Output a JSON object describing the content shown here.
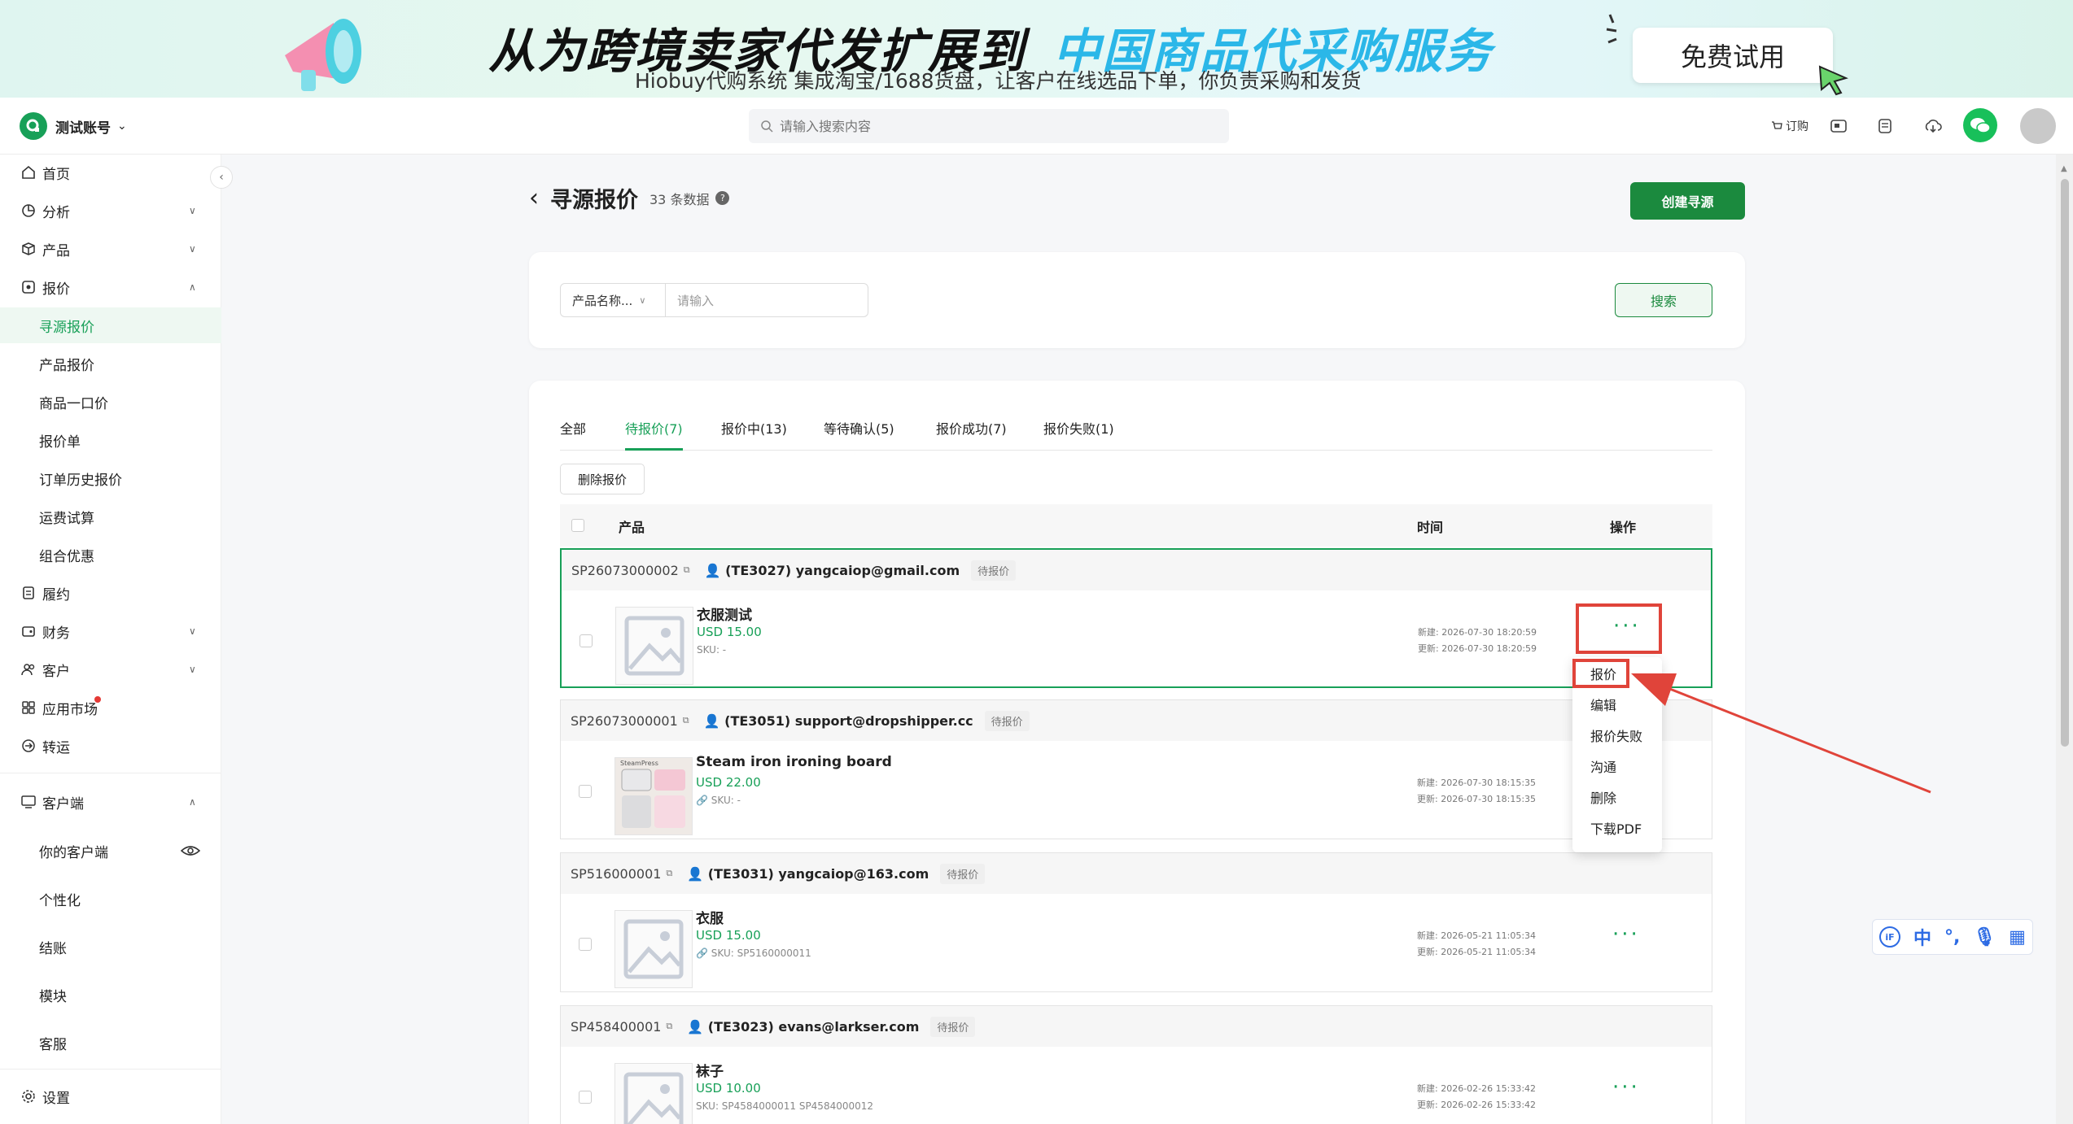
{
  "banner": {
    "headline_a": "从为跨境卖家代发扩展到",
    "headline_b": "中国商品代采购服务",
    "subtitle": "Hiobuy代购系统 集成淘宝/1688货盘，让客户在线选品下单，你负责采购和发货",
    "trial_button": "免费试用"
  },
  "topbar": {
    "account_name": "测试账号",
    "search_placeholder": "请输入搜索内容",
    "subscribe_label": "订购"
  },
  "sidebar": {
    "items": [
      {
        "label": "首页",
        "icon": "home-icon"
      },
      {
        "label": "分析",
        "icon": "chart-icon"
      },
      {
        "label": "产品",
        "icon": "box-icon"
      },
      {
        "label": "报价",
        "icon": "quote-icon"
      },
      {
        "label": "寻源报价"
      },
      {
        "label": "产品报价"
      },
      {
        "label": "商品一口价"
      },
      {
        "label": "报价单"
      },
      {
        "label": "订单历史报价"
      },
      {
        "label": "运费试算"
      },
      {
        "label": "组合优惠"
      },
      {
        "label": "履约",
        "icon": "fulfill-icon"
      },
      {
        "label": "财务",
        "icon": "finance-icon"
      },
      {
        "label": "客户",
        "icon": "customers-icon"
      },
      {
        "label": "应用市场",
        "icon": "apps-icon"
      },
      {
        "label": "转运",
        "icon": "transship-icon"
      },
      {
        "label": "客户端",
        "icon": "monitor-icon"
      },
      {
        "label": "你的客户端"
      },
      {
        "label": "个性化"
      },
      {
        "label": "结账"
      },
      {
        "label": "模块"
      },
      {
        "label": "客服"
      },
      {
        "label": "设置",
        "icon": "settings-icon"
      }
    ]
  },
  "page": {
    "title": "寻源报价",
    "count": "33 条数据",
    "create_button": "创建寻源"
  },
  "filter": {
    "field_select": "产品名称...",
    "input_placeholder": "请输入",
    "search_button": "搜索"
  },
  "tabs": [
    {
      "label": "全部"
    },
    {
      "label": "待报价(7)"
    },
    {
      "label": "报价中(13)"
    },
    {
      "label": "等待确认(5)"
    },
    {
      "label": "报价成功(7)"
    },
    {
      "label": "报价失败(1)"
    }
  ],
  "delete_button": "删除报价",
  "table_headers": {
    "product": "产品",
    "time": "时间",
    "actions": "操作"
  },
  "orders": [
    {
      "id": "SP26073000002",
      "user": "(TE3027) yangcaiop@gmail.com",
      "status": "待报价",
      "product": "衣服测试",
      "price": "USD 15.00",
      "sku": "SKU: -",
      "created": "新建: 2026-07-30 18:20:59",
      "updated": "更新: 2026-07-30 18:20:59"
    },
    {
      "id": "SP26073000001",
      "user": "(TE3051) support@dropshipper.cc",
      "status": "待报价",
      "product": "Steam iron ironing board",
      "price": "USD 22.00",
      "sku": "SKU: -",
      "created": "新建: 2026-07-30 18:15:35",
      "updated": "更新: 2026-07-30 18:15:35",
      "image_text": "SteamPress"
    },
    {
      "id": "SP516000001",
      "user": "(TE3031) yangcaiop@163.com",
      "status": "待报价",
      "product": "衣服",
      "price": "USD 15.00",
      "sku": "SKU:  SP5160000011",
      "created": "新建: 2026-05-21 11:05:34",
      "updated": "更新: 2026-05-21 11:05:34"
    },
    {
      "id": "SP458400001",
      "user": "(TE3023) evans@larkser.com",
      "status": "待报价",
      "product": "袜子",
      "price": "USD 10.00",
      "sku": "SKU:  SP4584000011    SP4584000012",
      "created": "新建: 2026-02-26 15:33:42",
      "updated": "更新: 2026-02-26 15:33:42"
    }
  ],
  "actions_menu": [
    "报价",
    "编辑",
    "报价失败",
    "沟通",
    "删除",
    "下载PDF"
  ],
  "colors": {
    "accent": "#18a058",
    "primary_button": "#1b8a3e",
    "annotation": "#e0443a"
  }
}
